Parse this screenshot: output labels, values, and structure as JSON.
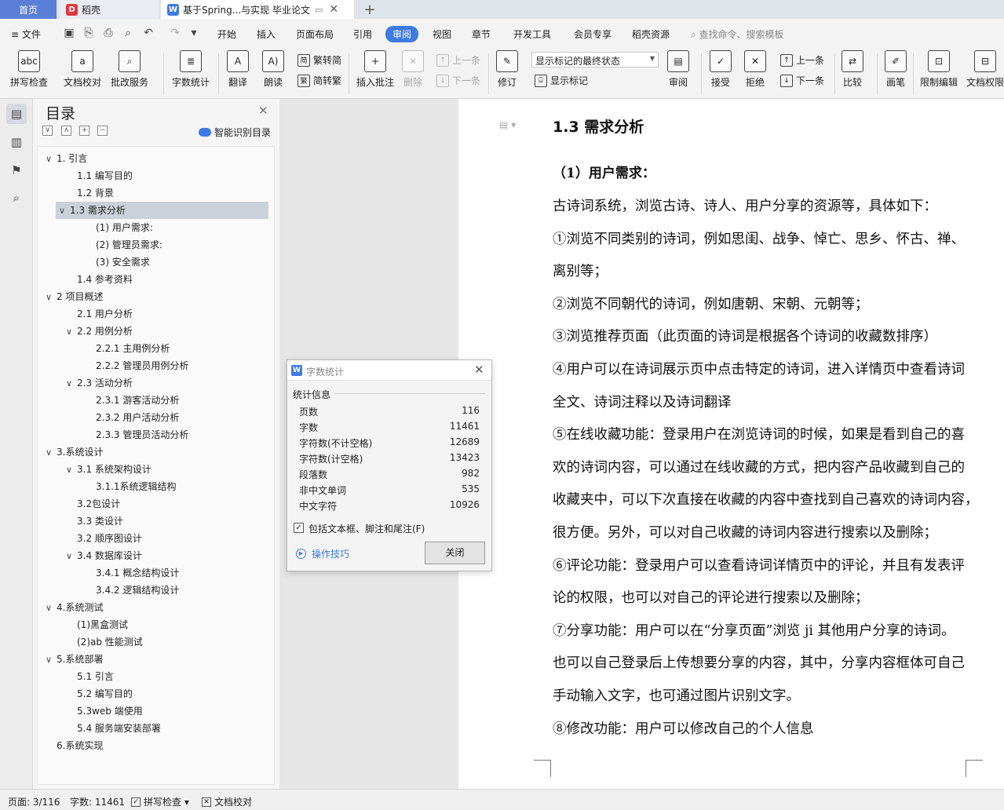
{
  "tabs": {
    "home": "首页",
    "daoke": "稻壳",
    "document": "基于Spring...与实现 毕业论文",
    "close_glyph": "✕",
    "new_tab_glyph": "+"
  },
  "menu": {
    "file": "文件",
    "items": [
      "开始",
      "插入",
      "页面布局",
      "引用",
      "审阅",
      "视图",
      "章节",
      "开发工具",
      "会员专享",
      "稻壳资源"
    ],
    "active": "审阅",
    "search": "查找命令、搜索模板"
  },
  "ribbon": {
    "spell_check": "拼写检查",
    "doc_proof": "文档校对",
    "batch_service": "批改服务",
    "word_count": "字数统计",
    "translate": "翻译",
    "read_aloud": "朗读",
    "trad_to_simp": "繁转简",
    "simp_to_trad": "简转繁",
    "insert_comment": "插入批注",
    "delete": "删除",
    "prev_comment": "上一条",
    "next_comment": "下一条",
    "revise": "修订",
    "markup_state": "显示标记的最终状态",
    "show_markup": "显示标记",
    "review": "审阅",
    "accept": "接受",
    "reject": "拒绝",
    "prev_change": "上一条",
    "next_change": "下一条",
    "compare": "比较",
    "pen": "画笔",
    "restrict_edit": "限制编辑",
    "doc_permission": "文档权限"
  },
  "toc": {
    "title": "目录",
    "smart": "智能识别目录",
    "items": [
      {
        "text": "1. 引言",
        "level": 0,
        "chev": "∨"
      },
      {
        "text": "1.1 编写目的",
        "level": 1
      },
      {
        "text": "1.2 背景",
        "level": 1
      },
      {
        "text": "1.3 需求分析",
        "level": 0,
        "chev": "∨",
        "active": true
      },
      {
        "text": "(1) 用户需求:",
        "level": 2
      },
      {
        "text": "(2) 管理员需求:",
        "level": 2
      },
      {
        "text": "(3) 安全需求",
        "level": 2
      },
      {
        "text": "1.4 参考资料",
        "level": 1
      },
      {
        "text": "2 项目概述",
        "level": 0,
        "chev": "∨"
      },
      {
        "text": "2.1 用户分析",
        "level": 1
      },
      {
        "text": "2.2 用例分析",
        "level": 1,
        "chev": "∨"
      },
      {
        "text": "2.2.1 主用例分析",
        "level": 2
      },
      {
        "text": "2.2.2 管理员用例分析",
        "level": 2
      },
      {
        "text": "2.3 活动分析",
        "level": 1,
        "chev": "∨"
      },
      {
        "text": "2.3.1 游客活动分析",
        "level": 2
      },
      {
        "text": "2.3.2 用户活动分析",
        "level": 2
      },
      {
        "text": "2.3.3 管理员活动分析",
        "level": 2
      },
      {
        "text": "3.系统设计",
        "level": 0,
        "chev": "∨"
      },
      {
        "text": "3.1 系统架构设计",
        "level": 1,
        "chev": "∨"
      },
      {
        "text": "3.1.1系统逻辑结构",
        "level": 2
      },
      {
        "text": "3.2包设计",
        "level": 1
      },
      {
        "text": "3.3 类设计",
        "level": 1
      },
      {
        "text": "3.2 顺序图设计",
        "level": 1
      },
      {
        "text": "3.4 数据库设计",
        "level": 1,
        "chev": "∨"
      },
      {
        "text": "3.4.1 概念结构设计",
        "level": 2
      },
      {
        "text": "3.4.2 逻辑结构设计",
        "level": 2
      },
      {
        "text": "4.系统测试",
        "level": 0,
        "chev": "∨"
      },
      {
        "text": "(1)黑盒测试",
        "level": 1
      },
      {
        "text": "(2)ab 性能测试",
        "level": 1
      },
      {
        "text": "5.系统部署",
        "level": 0,
        "chev": "∨"
      },
      {
        "text": "5.1 引言",
        "level": 1
      },
      {
        "text": "5.2 编写目的",
        "level": 1
      },
      {
        "text": "5.3web 端使用",
        "level": 1
      },
      {
        "text": "5.4 服务端安装部署",
        "level": 1
      },
      {
        "text": "6.系统实现",
        "level": 0
      }
    ]
  },
  "document": {
    "heading": "1.3 需求分析",
    "subheading": "（1）用户需求：",
    "lines": [
      "古诗词系统，浏览古诗、诗人、用户分享的资源等，具体如下：",
      "①浏览不同类别的诗词，例如思闺、战争、悼亡、思乡、怀古、禅、",
      "离别等；",
      "②浏览不同朝代的诗词，例如唐朝、宋朝、元朝等；",
      "③浏览推荐页面（此页面的诗词是根据各个诗词的收藏数排序）",
      "④用户可以在诗词展示页中点击特定的诗词，进入详情页中查看诗词",
      "全文、诗词注释以及诗词翻译",
      "⑤在线收藏功能：登录用户在浏览诗词的时候，如果是看到自己的喜",
      "欢的诗词内容，可以通过在线收藏的方式，把内容产品收藏到自己的",
      "收藏夹中，可以下次直接在收藏的内容中查找到自己喜欢的诗词内容，",
      "很方便。另外，可以对自己收藏的诗词内容进行搜索以及删除；",
      "⑥评论功能：登录用户可以查看诗词详情页中的评论，并且有发表评",
      "论的权限，也可以对自己的评论进行搜索以及删除；",
      "⑦分享功能：用户可以在“分享页面”浏览 ji 其他用户分享的诗词。",
      "也可以自己登录后上传想要分享的内容，其中，分享内容框体可自己",
      "手动输入文字，也可通过图片识别文字。",
      "⑧修改功能：用户可以修改自己的个人信息"
    ]
  },
  "dialog": {
    "title": "字数统计",
    "section": "统计信息",
    "stats": [
      {
        "label": "页数",
        "value": "116"
      },
      {
        "label": "字数",
        "value": "11461"
      },
      {
        "label": "字符数(不计空格)",
        "value": "12689"
      },
      {
        "label": "字符数(计空格)",
        "value": "13423"
      },
      {
        "label": "段落数",
        "value": "982"
      },
      {
        "label": "非中文单词",
        "value": "535"
      },
      {
        "label": "中文字符",
        "value": "10926"
      }
    ],
    "include_label": "包括文本框、脚注和尾注(F)",
    "include_checked": true,
    "tips": "操作技巧",
    "close": "关闭"
  },
  "status": {
    "page": "页面: 3/116",
    "words": "字数: 11461",
    "spell": "拼写检查",
    "proof": "文档校对"
  },
  "colors": {
    "accent": "#3e7ae3",
    "home_tab": "#5b7fd6",
    "toc_active": "#ccd1d9"
  }
}
